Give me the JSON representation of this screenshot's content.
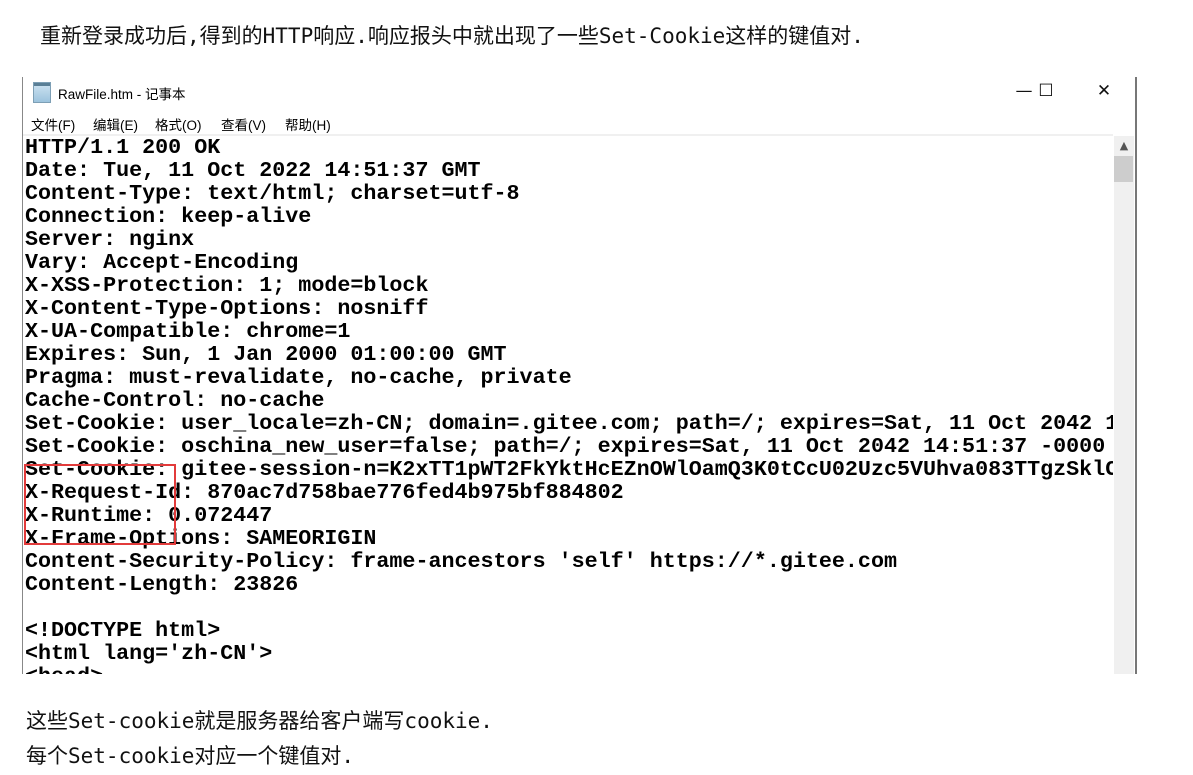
{
  "top_note": "重新登录成功后,得到的HTTP响应.响应报头中就出现了一些Set-Cookie这样的键值对.",
  "window": {
    "title": "RawFile.htm - 记事本",
    "buttons": {
      "minimize": "—",
      "maximize": "☐",
      "close": "✕"
    },
    "menu": [
      "文件(F)",
      "编辑(E)",
      "格式(O)",
      "查看(V)",
      "帮助(H)"
    ],
    "lines": [
      "HTTP/1.1 200 OK",
      "Date: Tue, 11 Oct 2022 14:51:37 GMT",
      "Content-Type: text/html; charset=utf-8",
      "Connection: keep-alive",
      "Server: nginx",
      "Vary: Accept-Encoding",
      "X-XSS-Protection: 1; mode=block",
      "X-Content-Type-Options: nosniff",
      "X-UA-Compatible: chrome=1",
      "Expires: Sun, 1 Jan 2000 01:00:00 GMT",
      "Pragma: must-revalidate, no-cache, private",
      "Cache-Control: no-cache",
      "Set-Cookie: user_locale=zh-CN; domain=.gitee.com; path=/; expires=Sat, 11 Oct 2042 1",
      "Set-Cookie: oschina_new_user=false; path=/; expires=Sat, 11 Oct 2042 14:51:37 -0000",
      "Set-Cookie: gitee-session-n=K2xTT1pWT2FkYktHcEZnOWlOamQ3K0tCcU02Uzc5VUhva083TTgzSklC",
      "X-Request-Id: 870ac7d758bae776fed4b975bf884802",
      "X-Runtime: 0.072447",
      "X-Frame-Options: SAMEORIGIN",
      "Content-Security-Policy: frame-ancestors 'self' https://*.gitee.com",
      "Content-Length: 23826",
      "",
      "<!DOCTYPE html>",
      "<html lang='zh-CN'>",
      "<head>"
    ],
    "highlight_color": "#e23b3b"
  },
  "bottom_notes": [
    "这些Set-cookie就是服务器给客户端写cookie.",
    "每个Set-cookie对应一个键值对."
  ]
}
